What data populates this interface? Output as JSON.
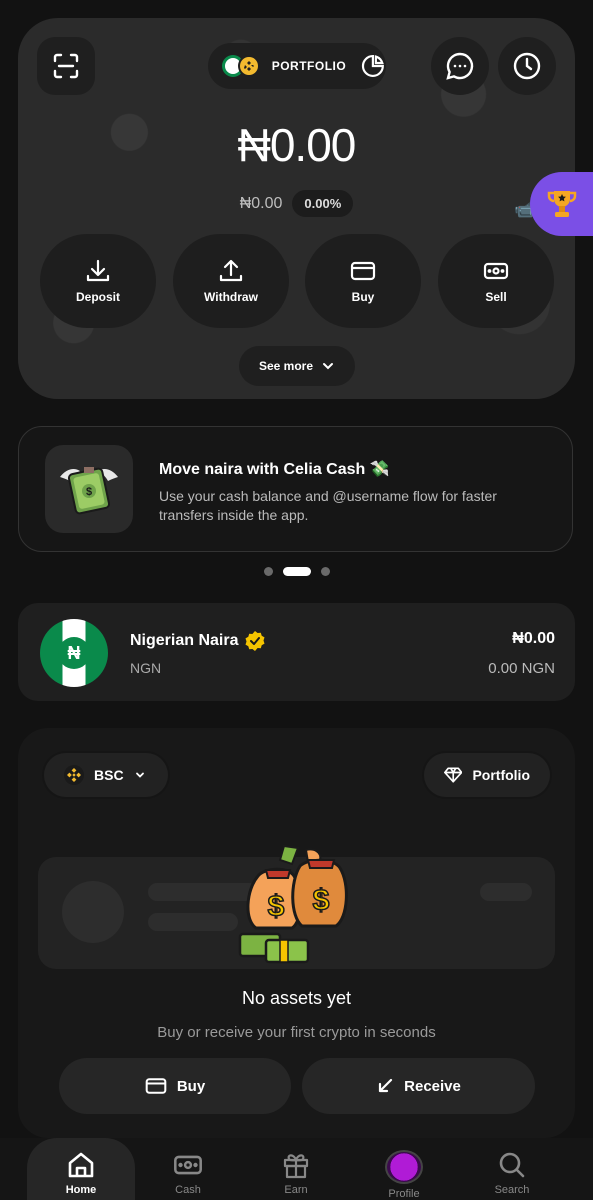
{
  "header": {
    "portfolio_label": "PORTFOLIO",
    "balance": "₦0.00",
    "sub_balance": "₦0.00",
    "change_pct": "0.00%"
  },
  "actions": [
    {
      "label": "Deposit",
      "icon": "download-icon"
    },
    {
      "label": "Withdraw",
      "icon": "upload-icon"
    },
    {
      "label": "Buy",
      "icon": "card-icon"
    },
    {
      "label": "Sell",
      "icon": "cash-icon"
    }
  ],
  "see_more": "See more",
  "promo": {
    "title": "Move naira with Celia Cash 💸",
    "body": "Use your cash balance and @username flow for faster transfers inside the app.",
    "pager": {
      "count": 3,
      "active": 2
    }
  },
  "currency": {
    "name": "Nigerian Naira",
    "code": "NGN",
    "amount": "₦0.00",
    "sub_amount": "0.00 NGN"
  },
  "assets": {
    "network": "BSC",
    "portfolio_label": "Portfolio",
    "empty_title": "No assets yet",
    "empty_sub": "Buy or receive your first crypto in seconds",
    "buy_label": "Buy",
    "receive_label": "Receive"
  },
  "nav": [
    {
      "label": "Home",
      "icon": "home-icon",
      "active": true
    },
    {
      "label": "Cash",
      "icon": "cash-icon"
    },
    {
      "label": "Earn",
      "icon": "gift-icon"
    },
    {
      "label": "Profile",
      "icon": "avatar"
    },
    {
      "label": "Search",
      "icon": "search-icon"
    }
  ],
  "colors": {
    "background": "#121212",
    "card": "#2b2b2b",
    "accent_purple": "#7b4fe6",
    "naira_green": "#0a8a4b",
    "bnb_yellow": "#f3ba2f"
  }
}
